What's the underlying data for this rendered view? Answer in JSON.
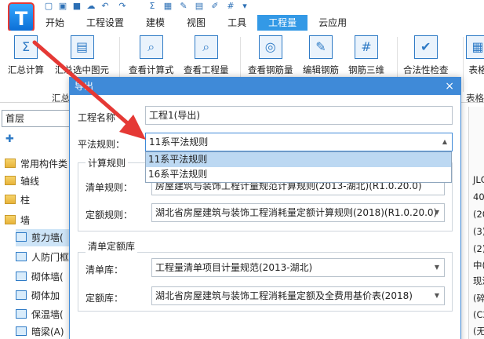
{
  "app": {
    "logo_text": "T"
  },
  "menu": {
    "tabs": [
      "开始",
      "工程设置",
      "建模",
      "视图",
      "工具",
      "工程量",
      "云应用"
    ],
    "active_index": 5
  },
  "ribbon": {
    "buttons": [
      {
        "label": "汇总计算",
        "icon": "sigma-icon"
      },
      {
        "label": "汇总选中图元",
        "icon": "sum-selected-icon"
      },
      {
        "label": "查看计算式",
        "icon": "view-formula-icon"
      },
      {
        "label": "查看工程量",
        "icon": "view-quantity-icon"
      },
      {
        "label": "查看钢筋量",
        "icon": "view-rebar-icon"
      },
      {
        "label": "编辑钢筋",
        "icon": "edit-rebar-icon"
      },
      {
        "label": "钢筋三维",
        "icon": "rebar-3d-icon"
      },
      {
        "label": "合法性检查",
        "icon": "check-icon"
      },
      {
        "label": "表格",
        "icon": "table-icon"
      }
    ],
    "groups": [
      "汇总",
      "表格"
    ]
  },
  "left_panel": {
    "floor_value": "首层",
    "tree": [
      {
        "label": "常用构件类",
        "kind": "folder"
      },
      {
        "label": "轴线",
        "kind": "folder"
      },
      {
        "label": "柱",
        "kind": "folder"
      },
      {
        "label": "墙",
        "kind": "folder"
      },
      {
        "label": "剪力墙(",
        "kind": "comp"
      },
      {
        "label": "人防门框",
        "kind": "comp"
      },
      {
        "label": "砌体墙(",
        "kind": "comp"
      },
      {
        "label": "砌体加",
        "kind": "comp"
      },
      {
        "label": "保温墙(",
        "kind": "comp"
      },
      {
        "label": "暗梁(A)",
        "kind": "comp"
      }
    ]
  },
  "right_cells": [
    "JLG",
    "40",
    "(20",
    "(3)",
    "(2)",
    "中(",
    "现浇",
    "(碎",
    "(C2",
    "(无"
  ],
  "dialog": {
    "title": "导出",
    "close_symbol": "×",
    "project_name_label": "工程名称",
    "project_name_value": "工程1(导出)",
    "rule_label": "平法规则：",
    "rule_value": "11系平法规则",
    "rule_options": [
      "11系平法规则",
      "16系平法规则"
    ],
    "calc_group_title": "计算规则",
    "bill_rule_label": "清单规则：",
    "bill_rule_value": "房屋建筑与装饰工程计量规范计算规则(2013-湖北)(R1.0.20.0)",
    "quota_rule_label": "定额规则：",
    "quota_rule_value": "湖北省房屋建筑与装饰工程消耗量定额计算规则(2018)(R1.0.20.0)",
    "lib_group_title": "清单定额库",
    "bill_lib_label": "清单库：",
    "bill_lib_value": "工程量清单项目计量规范(2013-湖北)",
    "quota_lib_label": "定额库：",
    "quota_lib_value": "湖北省房屋建筑与装饰工程消耗量定额及全费用基价表(2018)"
  },
  "colors": {
    "accent": "#3399e6",
    "annotation": "#e53935"
  }
}
